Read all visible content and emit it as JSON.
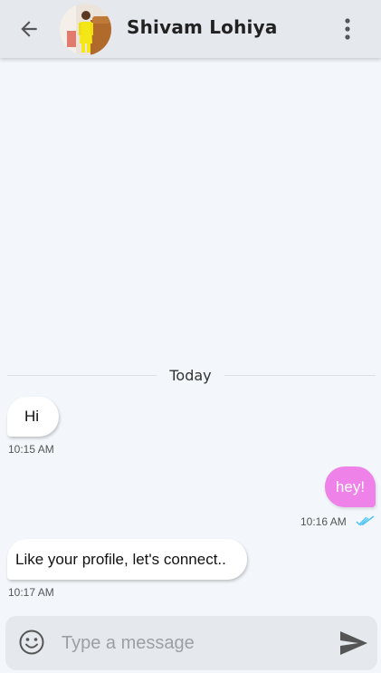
{
  "header": {
    "contact_name": "Shivam Lohiya",
    "back_icon": "arrow-left-icon",
    "menu_icon": "more-vertical-icon"
  },
  "conversation": {
    "date_label": "Today",
    "messages": [
      {
        "direction": "incoming",
        "text": "Hi",
        "time": "10:15 AM"
      },
      {
        "direction": "outgoing",
        "text": "hey!",
        "time": "10:16 AM",
        "status": "read"
      },
      {
        "direction": "incoming",
        "text": "Like your profile, let's connect..",
        "time": "10:17 AM"
      }
    ]
  },
  "composer": {
    "placeholder": "Type a message",
    "value": "",
    "emoji_icon": "emoji-smile-icon",
    "send_icon": "send-icon"
  },
  "colors": {
    "outgoing_bubble": "#ee82e9",
    "read_ticks": "#4fc3f7",
    "background": "#f3f7fb",
    "header": "#e5e9ed"
  }
}
